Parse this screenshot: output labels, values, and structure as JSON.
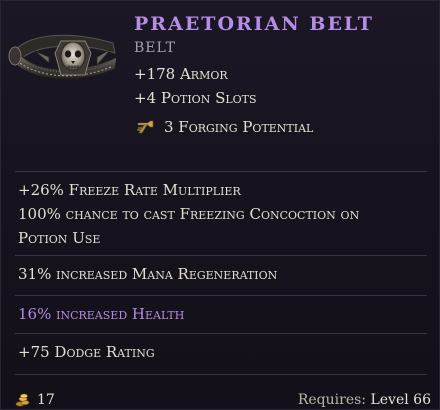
{
  "item": {
    "name": "Praetorian Belt",
    "type": "Belt",
    "implicits": [
      "+178 Armor",
      "+4 Potion Slots"
    ],
    "forging": "3 Forging Potential"
  },
  "affixes": {
    "block1": [
      "+26% Freeze Rate Multiplier",
      "100% chance to cast Freezing Concoction on",
      "Potion Use"
    ],
    "block2": [
      "31% increased Mana Regeneration"
    ],
    "block3": [
      "16% increased Health"
    ],
    "block4": [
      "+75 Dodge Rating"
    ]
  },
  "footer": {
    "gold": "17",
    "requires_label": "Requires:",
    "requires_level": "Level 66"
  },
  "colors": {
    "name": "#b58ce6",
    "highlight": "#b48be2",
    "background": "#17131f",
    "divider": "#3b3345"
  },
  "icons": {
    "item_art": "belt-icon",
    "forging": "hammer-icon",
    "currency": "gold-coin-icon"
  }
}
